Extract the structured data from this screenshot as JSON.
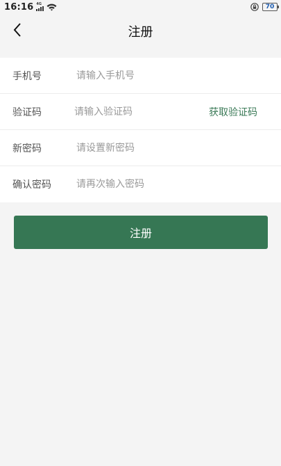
{
  "status_bar": {
    "time": "16:16",
    "network_label": "4G",
    "battery_level": "70",
    "icons": [
      "signal-icon",
      "wifi-icon",
      "lock-rotation-icon",
      "battery-icon"
    ]
  },
  "header": {
    "title": "注册",
    "back_icon": "chevron-left-icon"
  },
  "form": {
    "phone": {
      "label": "手机号",
      "placeholder": "请输入手机号",
      "value": ""
    },
    "code": {
      "label": "验证码",
      "placeholder": "请输入验证码",
      "value": "",
      "action_label": "获取验证码"
    },
    "new_password": {
      "label": "新密码",
      "placeholder": "请设置新密码",
      "value": ""
    },
    "confirm_password": {
      "label": "确认密码",
      "placeholder": "请再次输入密码",
      "value": ""
    }
  },
  "submit": {
    "label": "注册"
  },
  "colors": {
    "background": "#f4f4f4",
    "accent": "#367754",
    "accent_text": "#3b7a57",
    "battery_text": "#1b5bb0"
  }
}
